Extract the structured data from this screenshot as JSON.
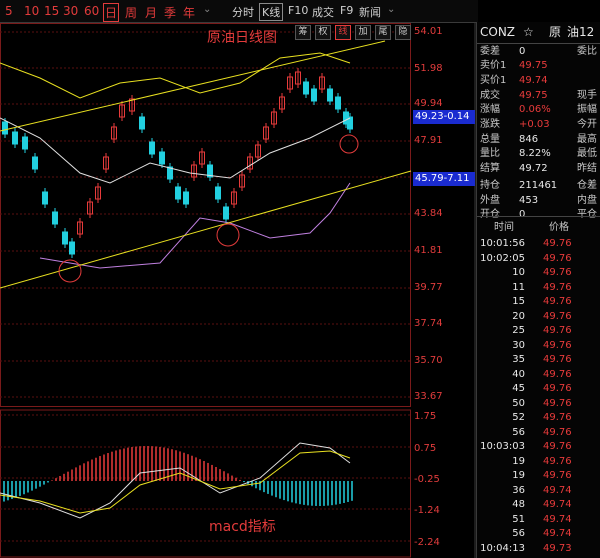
{
  "toolbar": {
    "periods": [
      "5",
      "10",
      "15",
      "30",
      "60",
      "日",
      "周",
      "月",
      "季",
      "年"
    ],
    "active_period": "日",
    "buttons": [
      "分时",
      "K线",
      "F10",
      "成交",
      "F9",
      "新闻"
    ],
    "active_button": "K线"
  },
  "chart": {
    "title": "原油日线图",
    "macd_label": "macd指标",
    "tools": [
      "筹",
      "权",
      "线",
      "加",
      "尾",
      "隐"
    ],
    "active_tool": "线",
    "price_ticks": [
      "54.01",
      "51.98",
      "49.94",
      "47.91",
      "45.87",
      "43.84",
      "41.81",
      "39.77",
      "37.74",
      "35.70",
      "33.67"
    ],
    "price_label_upper": "49.23-0.14",
    "price_label_lower": "45.79-7.11",
    "macd_ticks": [
      "1.75",
      "0.75",
      "-0.25",
      "-1.24",
      "-2.24"
    ],
    "colors": {
      "up": "#e83b3b",
      "down": "#22d0e0",
      "trend": "#e8e020",
      "ma_white": "#e0e0e0",
      "ma_yellow": "#e8e020",
      "ma_purple": "#c080e0",
      "label_blue": "#1a2bd0"
    }
  },
  "panel": {
    "symbol": "CONZ",
    "star": "☆",
    "name": "原",
    "name2": "油12",
    "rows": [
      {
        "label": "委差",
        "value": "0",
        "color": "white",
        "extra": "委比"
      },
      {
        "label": "卖价1",
        "value": "49.75",
        "color": "red",
        "extra": ""
      },
      {
        "label": "买价1",
        "value": "49.74",
        "color": "red",
        "extra": ""
      },
      {
        "label": "成交",
        "value": "49.75",
        "color": "red",
        "extra": "现手"
      },
      {
        "label": "涨幅",
        "value": "0.06%",
        "color": "red",
        "extra": "振幅"
      },
      {
        "label": "涨跌",
        "value": "+0.03",
        "color": "red",
        "extra": "今开"
      },
      {
        "label": "总量",
        "value": "846",
        "color": "white",
        "extra": "最高"
      },
      {
        "label": "量比",
        "value": "8.22%",
        "color": "white",
        "extra": "最低"
      },
      {
        "label": "结算",
        "value": "49.72",
        "color": "white",
        "extra": "昨结"
      },
      {
        "label": "持仓",
        "value": "211461",
        "color": "white",
        "extra": "仓差"
      },
      {
        "label": "外盘",
        "value": "453",
        "color": "white",
        "extra": "内盘"
      },
      {
        "label": "开仓",
        "value": "0",
        "color": "white",
        "extra": "平仓"
      }
    ],
    "trades_header": [
      "时间",
      "价格"
    ],
    "trades": [
      {
        "time": "10:01:56",
        "price": "49.76"
      },
      {
        "time": "10:02:05",
        "price": "49.76"
      },
      {
        "time": "10",
        "price": "49.76"
      },
      {
        "time": "11",
        "price": "49.76"
      },
      {
        "time": "15",
        "price": "49.76"
      },
      {
        "time": "20",
        "price": "49.76"
      },
      {
        "time": "25",
        "price": "49.76"
      },
      {
        "time": "30",
        "price": "49.76"
      },
      {
        "time": "35",
        "price": "49.76"
      },
      {
        "time": "40",
        "price": "49.76"
      },
      {
        "time": "45",
        "price": "49.76"
      },
      {
        "time": "50",
        "price": "49.76"
      },
      {
        "time": "52",
        "price": "49.76"
      },
      {
        "time": "56",
        "price": "49.76"
      },
      {
        "time": "10:03:03",
        "price": "49.76"
      },
      {
        "time": "19",
        "price": "49.76"
      },
      {
        "time": "19",
        "price": "49.76"
      },
      {
        "time": "36",
        "price": "49.74"
      },
      {
        "time": "48",
        "price": "49.74"
      },
      {
        "time": "51",
        "price": "49.74"
      },
      {
        "time": "56",
        "price": "49.74"
      },
      {
        "time": "10:04:13",
        "price": "49.73"
      }
    ]
  }
}
